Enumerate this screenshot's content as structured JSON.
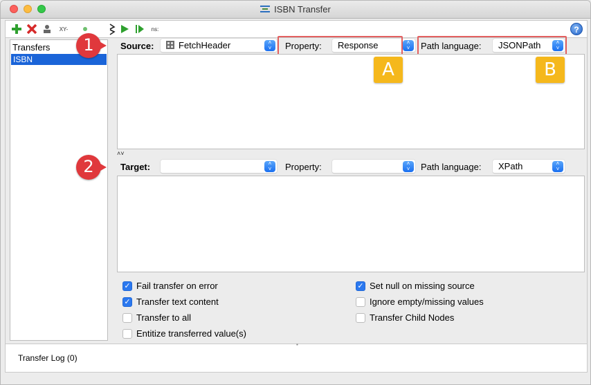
{
  "window": {
    "title": "ISBN Transfer"
  },
  "toolbar": {
    "buttons": [
      {
        "icon": "add-icon"
      },
      {
        "icon": "delete-icon"
      },
      {
        "icon": "rename-icon"
      },
      {
        "icon": "xpath-icon",
        "label": "XY-"
      },
      {
        "icon": "status-dot-icon"
      },
      {
        "icon": "sort-icon"
      },
      {
        "icon": "run-icon"
      },
      {
        "icon": "run-all-icon"
      },
      {
        "icon": "namespace-icon",
        "label": "ns:"
      }
    ],
    "help_icon": "?"
  },
  "transfers": {
    "header": "Transfers",
    "items": [
      "ISBN"
    ]
  },
  "source": {
    "label": "Source:",
    "value": "FetchHeader",
    "property_label": "Property:",
    "property_value": "Response",
    "path_language_label": "Path language:",
    "path_language_value": "JSONPath"
  },
  "target": {
    "label": "Target:",
    "value": "",
    "property_label": "Property:",
    "property_value": "",
    "path_language_label": "Path language:",
    "path_language_value": "XPath"
  },
  "annotations": {
    "badge_1": "1",
    "badge_2": "2",
    "badge_a": "A",
    "badge_b": "B"
  },
  "options": {
    "left": [
      {
        "label": "Fail transfer on error",
        "checked": true
      },
      {
        "label": "Transfer text content",
        "checked": true
      },
      {
        "label": "Transfer to all",
        "checked": false
      },
      {
        "label": "Entitize transferred value(s)",
        "checked": false
      }
    ],
    "right": [
      {
        "label": "Set null on missing source",
        "checked": true
      },
      {
        "label": "Ignore empty/missing values",
        "checked": false
      },
      {
        "label": "Transfer Child Nodes",
        "checked": false
      }
    ]
  },
  "log": {
    "label": "Transfer Log (0)"
  },
  "colors": {
    "accent": "#1a64d8",
    "annotation_red": "#e0383c",
    "annotation_yellow": "#f5b81c",
    "frame_red": "#e35f5f"
  }
}
